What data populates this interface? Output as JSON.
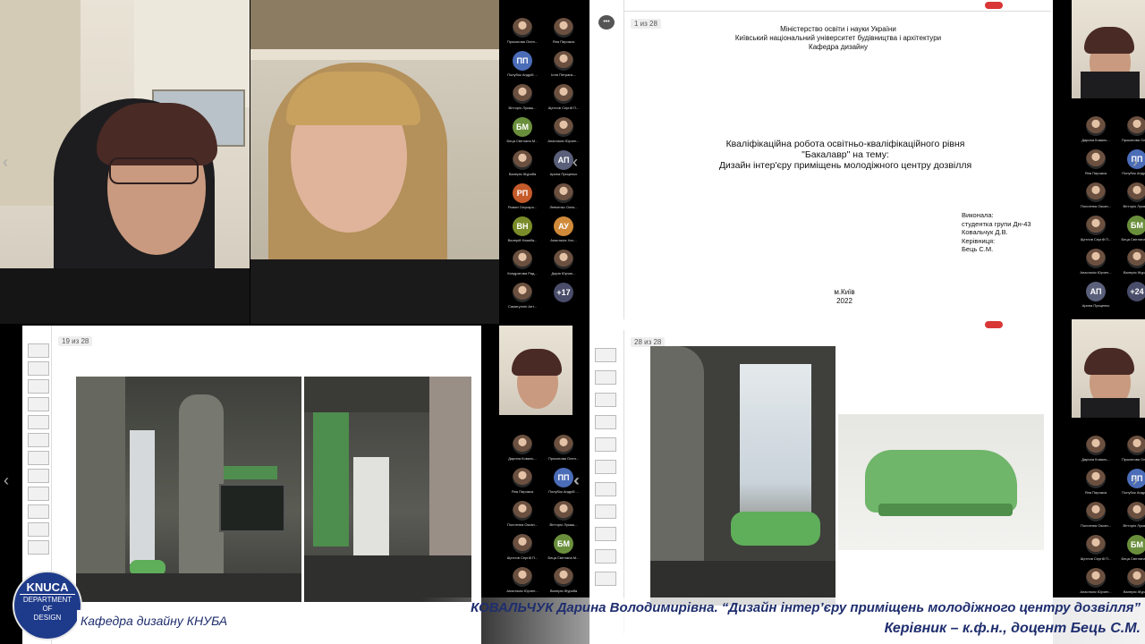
{
  "video_tiles": {
    "teacher": "",
    "student": ""
  },
  "panel_left_top": [
    {
      "initials": "",
      "name": "Прокопова Олен..."
    },
    {
      "initials": "",
      "name": "Яна Пирожок"
    },
    {
      "initials": "ПП",
      "name": "Полубок Андрій ...",
      "color": "#4b6cb7"
    },
    {
      "initials": "",
      "name": "Ілля Петрань..."
    },
    {
      "initials": "",
      "name": "Вітторіо Лукаш..."
    },
    {
      "initials": "",
      "name": "Щеглов Сергій П..."
    },
    {
      "initials": "БМ",
      "name": "Беца Світлана М...",
      "color": "#6a8f3c"
    },
    {
      "initials": "",
      "name": "Анастасія Юрчен..."
    },
    {
      "initials": "",
      "name": "Валерія Жураба"
    },
    {
      "initials": "АП",
      "name": "Арина Прицепко",
      "color": "#5a5f7a"
    },
    {
      "initials": "РП",
      "name": "Роман Олусаро...",
      "color": "#c55a2a"
    },
    {
      "initials": "",
      "name": "Левченко Олек..."
    },
    {
      "initials": "ВН",
      "name": "Валерій Назаба...",
      "color": "#7a8c2a"
    },
    {
      "initials": "АУ",
      "name": "Анастасія Хоч...",
      "color": "#d08a3a"
    },
    {
      "initials": "",
      "name": "Кондратова Рад..."
    },
    {
      "initials": "",
      "name": "Дарія Юрчик..."
    },
    {
      "initials": "",
      "name": "Самигуллін Ант..."
    },
    {
      "initials": "+17",
      "name": "",
      "color": "#4a4d6a"
    }
  ],
  "panel_right_top": [
    {
      "initials": "",
      "name": "Дарина Коваль..."
    },
    {
      "initials": "",
      "name": "Прокопова Олен..."
    },
    {
      "initials": "",
      "name": "Яна Пирожок"
    },
    {
      "initials": "ПП",
      "name": "Полубок Андрій ...",
      "color": "#4b6cb7"
    },
    {
      "initials": "",
      "name": "Полотнюк Оксан..."
    },
    {
      "initials": "",
      "name": "Вітторіо Лукаш..."
    },
    {
      "initials": "",
      "name": "Щеглов Сергій П..."
    },
    {
      "initials": "БМ",
      "name": "Беца Світлана М...",
      "color": "#6a8f3c"
    },
    {
      "initials": "",
      "name": "Анастасія Юрчен..."
    },
    {
      "initials": "",
      "name": "Валерія Жураба"
    },
    {
      "initials": "АП",
      "name": "Арина Прицепко",
      "color": "#5a5f7a"
    },
    {
      "initials": "+24",
      "name": "",
      "color": "#4a4d6a"
    }
  ],
  "panel_left_bottom": [
    {
      "initials": "",
      "name": "Дарина Коваль..."
    },
    {
      "initials": "",
      "name": "Прокопова Олен..."
    },
    {
      "initials": "",
      "name": "Яна Пирожок"
    },
    {
      "initials": "ПП",
      "name": "Полубок Андрій ...",
      "color": "#4b6cb7"
    },
    {
      "initials": "",
      "name": "Полотнюк Оксан..."
    },
    {
      "initials": "",
      "name": "Вітторіо Лукаш..."
    },
    {
      "initials": "",
      "name": "Щеглов Сергій П..."
    },
    {
      "initials": "БМ",
      "name": "Беца Світлана М...",
      "color": "#6a8f3c"
    },
    {
      "initials": "",
      "name": "Анастасія Юрчен..."
    },
    {
      "initials": "",
      "name": "Валерія Жураба"
    }
  ],
  "panel_right_bottom": [
    {
      "initials": "",
      "name": "Дарина Коваль..."
    },
    {
      "initials": "",
      "name": "Прокопова Олен..."
    },
    {
      "initials": "",
      "name": "Яна Пирожок"
    },
    {
      "initials": "ПП",
      "name": "Полубок Андрій ...",
      "color": "#4b6cb7"
    },
    {
      "initials": "",
      "name": "Полотнюк Оксан..."
    },
    {
      "initials": "",
      "name": "Вітторіо Лукаш..."
    },
    {
      "initials": "",
      "name": "Щеглов Сергій П..."
    },
    {
      "initials": "БМ",
      "name": "Беца Світлана М...",
      "color": "#6a8f3c"
    },
    {
      "initials": "",
      "name": "Анастасія Юрчен..."
    },
    {
      "initials": "",
      "name": "Валерія Жураба"
    }
  ],
  "slide1": {
    "page": "1 из 28",
    "ministry": "Міністерство освіти і науки України",
    "university": "Київський національний університет будівництва і архітектури",
    "department": "Кафедра дизайну",
    "title1": "Кваліфікаційна робота освітньо-кваліфікаційного рівня",
    "title2": "\"Бакалавр\" на тему:",
    "title3": "Дизайн інтер'єру приміщень молодіжного центру дозвілля",
    "info1": "Виконала:",
    "info2": "студентка групи Дн-43",
    "info3": "Ковальчук Д.В.",
    "info4": "Керівниця:",
    "info5": "Бець С.М.",
    "city": "м.Київ",
    "year": "2022"
  },
  "slide19": {
    "page": "19 из 28"
  },
  "slide28": {
    "page": "28 из 28"
  },
  "logo": {
    "line1": "KNUCA",
    "line2": "DEPARTMENT",
    "line3": "OF",
    "line4": "DESIGN"
  },
  "caption_left": "Кафедра дизайну КНУБА",
  "caption_right_1": "КОВАЛЬЧУК Дарина Володимирівна. “Дизайн інтер’єру приміщень молодіжного центру дозвілля”",
  "caption_right_2": "Керівник – к.ф.н., доцент Бець С.М."
}
